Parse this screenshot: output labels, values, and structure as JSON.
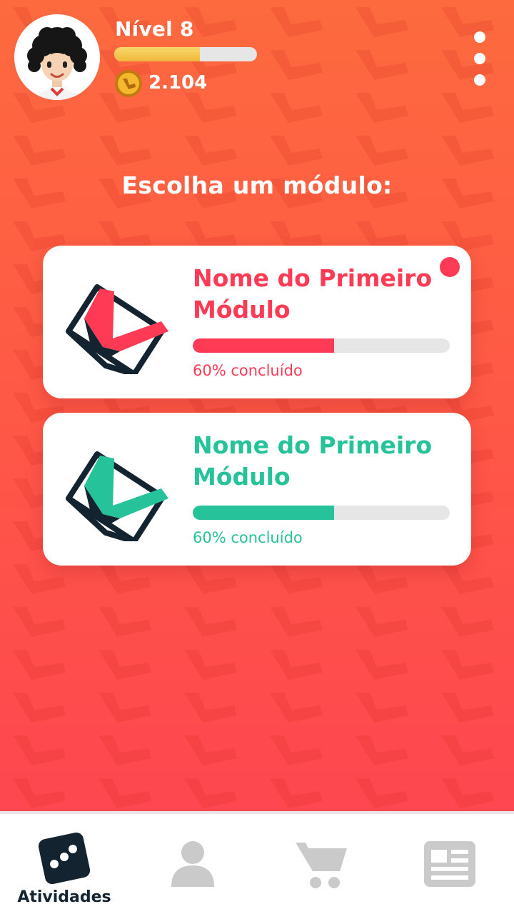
{
  "colors": {
    "accent_red": "#fe3a55",
    "accent_green": "#26c29a",
    "dark_navy": "#13232f",
    "inactive_gray": "#cacaca",
    "gold": "#f0b83b"
  },
  "header": {
    "level_label": "Nível 8",
    "xp_progress": 0.6,
    "coins": "2.104",
    "coin_icon": "coin-icon",
    "menu_icon": "more-vertical-icon"
  },
  "main": {
    "title": "Escolha um módulo:",
    "modules": [
      {
        "title": "Nome do Primeiro Módulo",
        "progress": 0.55,
        "progress_label": "60% concluído",
        "color": "#fe3a55",
        "has_notification": true,
        "icon": "module-book-icon"
      },
      {
        "title": "Nome do Primeiro Módulo",
        "progress": 0.55,
        "progress_label": "60% concluído",
        "color": "#26c29a",
        "has_notification": false,
        "icon": "module-book-icon"
      }
    ]
  },
  "tabbar": {
    "tabs": [
      {
        "label": "Atividades",
        "icon": "dice-icon",
        "active": true
      },
      {
        "label": "",
        "icon": "profile-icon",
        "active": false
      },
      {
        "label": "",
        "icon": "cart-icon",
        "active": false
      },
      {
        "label": "",
        "icon": "news-icon",
        "active": false
      }
    ]
  }
}
